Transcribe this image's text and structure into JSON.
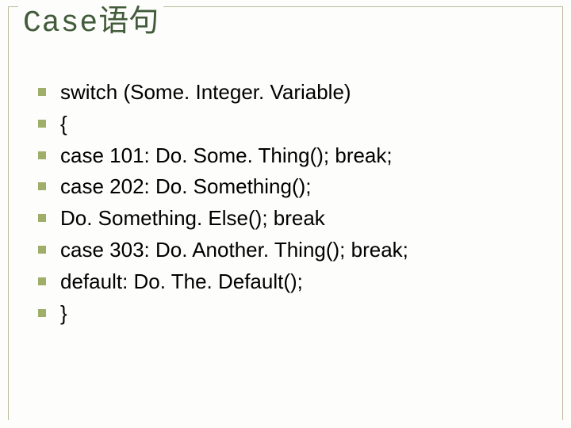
{
  "slide": {
    "title_mono": "Case",
    "title_cjk": "语句",
    "bullets": [
      "switch (Some. Integer. Variable)",
      "{",
      "case 101: Do. Some. Thing(); break;",
      "case 202: Do. Something();",
      "Do. Something. Else(); break",
      "case 303: Do. Another. Thing(); break;",
      "default: Do. The. Default();",
      "}"
    ]
  }
}
